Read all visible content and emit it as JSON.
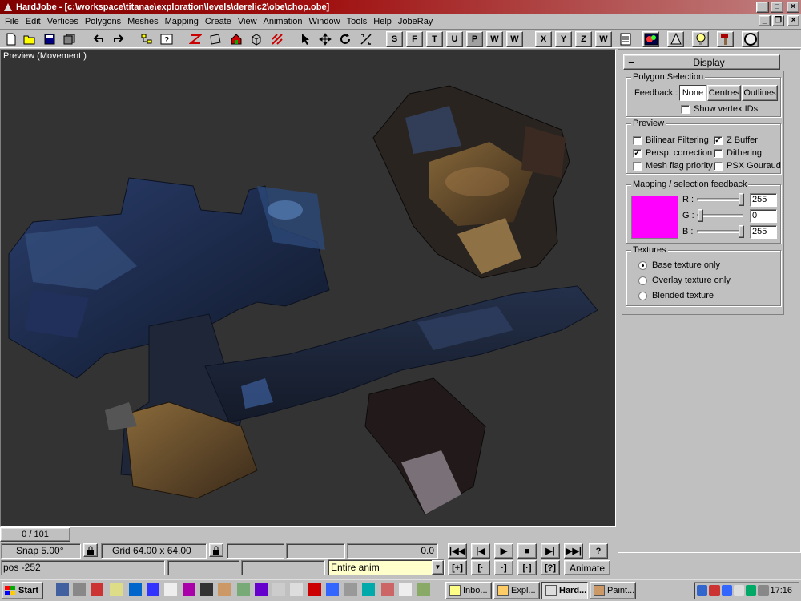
{
  "window": {
    "title": "HardJobe - [c:\\workspace\\titanae\\exploration\\levels\\derelic2\\obe\\chop.obe]",
    "min_label": "_",
    "max_label": "□",
    "close_label": "×",
    "mdi_min_label": "_",
    "mdi_restore_label": "❐",
    "mdi_close_label": "×"
  },
  "menu": [
    {
      "label": "File"
    },
    {
      "label": "Edit"
    },
    {
      "label": "Vertices"
    },
    {
      "label": "Polygons"
    },
    {
      "label": "Meshes"
    },
    {
      "label": "Mapping"
    },
    {
      "label": "Create"
    },
    {
      "label": "View"
    },
    {
      "label": "Animation"
    },
    {
      "label": "Window"
    },
    {
      "label": "Tools"
    },
    {
      "label": "Help"
    },
    {
      "label": "JobeRay"
    }
  ],
  "toolbar": {
    "glyphs": [
      "new-icon",
      "open-icon",
      "save-icon",
      "save-all-icon",
      "undo-icon",
      "redo-icon",
      "tree-icon",
      "help-query-icon",
      "line-tool-icon",
      "poly-tool-icon",
      "house-icon",
      "cube-icon",
      "hatch-icon",
      "select-arrow-icon",
      "move-icon",
      "rotate-icon",
      "scale-icon"
    ],
    "view_buttons": [
      "S",
      "F",
      "T",
      "U",
      "P",
      "W",
      "W"
    ],
    "axis_buttons": [
      "X",
      "Y",
      "Z",
      "W"
    ]
  },
  "viewport": {
    "label": "Preview (Movement )"
  },
  "panel": {
    "collapse_label": "−",
    "header": "Display",
    "polygon_selection": {
      "legend": "Polygon Selection",
      "feedback_label": "Feedback :",
      "buttons": [
        "None",
        "Centres",
        "Outlines"
      ],
      "selected": "None",
      "show_vertex_ids": {
        "label": "Show vertex IDs",
        "checked": false
      }
    },
    "preview": {
      "legend": "Preview",
      "options": [
        {
          "label": "Bilinear Filtering",
          "checked": false
        },
        {
          "label": "Z Buffer",
          "checked": true
        },
        {
          "label": "Persp. correction",
          "checked": true
        },
        {
          "label": "Dithering",
          "checked": false
        },
        {
          "label": "Mesh flag priority",
          "checked": false
        },
        {
          "label": "PSX Gouraud",
          "checked": false
        }
      ]
    },
    "mapping": {
      "legend": "Mapping / selection feedback",
      "swatch_color": "#ff00ff",
      "r": {
        "label": "R :",
        "value": "255",
        "level": 255
      },
      "g": {
        "label": "G :",
        "value": "0",
        "level": 0
      },
      "b": {
        "label": "B :",
        "value": "255",
        "level": 255
      }
    },
    "textures": {
      "legend": "Textures",
      "options": [
        {
          "label": "Base texture only",
          "selected": true
        },
        {
          "label": "Overlay texture only",
          "selected": false
        },
        {
          "label": "Blended texture",
          "selected": false
        }
      ]
    }
  },
  "frame_counter": "0 / 101",
  "status": {
    "snap": "Snap 5.00°",
    "grid": "Grid 64.00 x 64.00",
    "time": "0.0",
    "pos": "pos -252",
    "anim_range": "Entire anim",
    "animate_label": "Animate"
  },
  "playback": {
    "row1": [
      "|◀◀",
      "|◀",
      "▶",
      "■",
      "▶|",
      "▶▶|",
      "?"
    ],
    "row2": [
      "[+]",
      "[·",
      "·]",
      "[·]",
      "[?]"
    ]
  },
  "taskbar": {
    "start_label": "Start",
    "tasks": [
      {
        "label": "Inbo...",
        "active": false
      },
      {
        "label": "Expl...",
        "active": false
      },
      {
        "label": "Hard...",
        "active": true
      },
      {
        "label": "Paint...",
        "active": false
      }
    ],
    "clock": "17:16"
  }
}
